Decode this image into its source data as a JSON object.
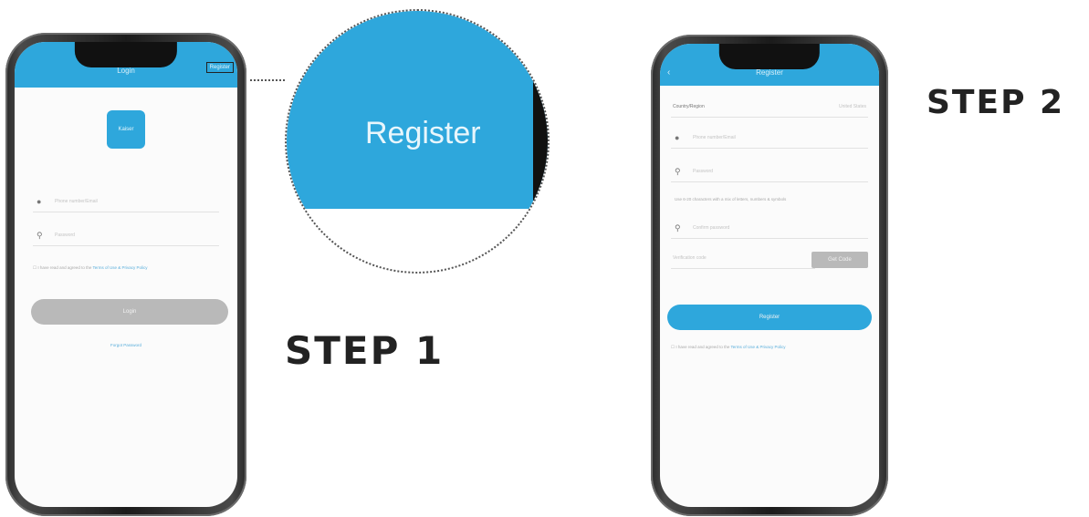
{
  "step1": {
    "label": "STEP 1",
    "login_screen": {
      "title": "Login",
      "register_button": "Register",
      "logo_text": "Kaiser",
      "username_placeholder": "Phone number/Email",
      "password_placeholder": "Password",
      "agreement_text": "I have read and agreed to the",
      "agreement_link": "Terms of Use & Privacy Policy",
      "login_button": "Login",
      "forgot_password": "Forgot Password"
    },
    "zoom_label": "Register"
  },
  "step2": {
    "label": "STEP 2",
    "register_screen": {
      "title": "Register",
      "back_icon": "chevron-left-icon",
      "country_label": "Country/Region",
      "country_value": "United States",
      "account_placeholder": "Phone number/Email",
      "password_placeholder": "Password",
      "password_hint": "Use 6-20 characters with a mix of letters, numbers & symbols",
      "confirm_placeholder": "Confirm password",
      "code_placeholder": "Verification code",
      "get_code_button": "Get Code",
      "register_button": "Register",
      "agreement_text": "I have read and agreed to the",
      "agreement_link": "Terms of Use & Privacy Policy"
    }
  },
  "colors": {
    "accent": "#2ea7dc",
    "disabled": "#b9b9b9",
    "text": "#222222"
  }
}
